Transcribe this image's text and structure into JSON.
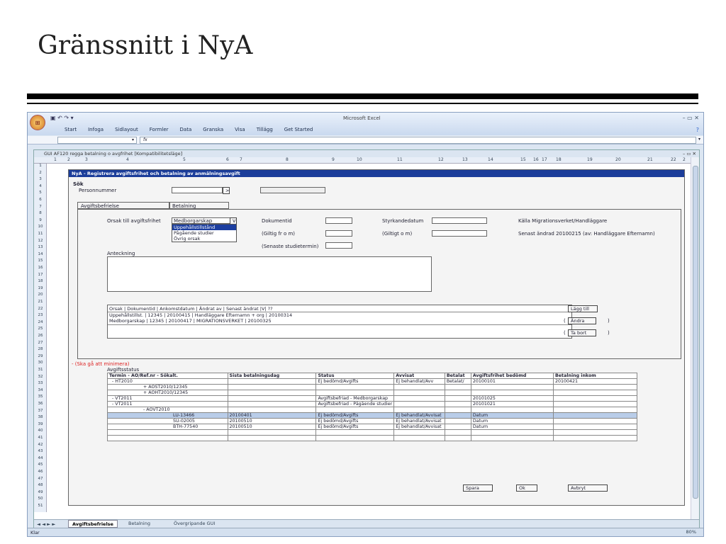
{
  "slide": {
    "title": "Gränssnitt i NyA"
  },
  "excel": {
    "app_title": "Microsoft Excel",
    "office_button": "⊞",
    "qat": "▣ ↶ ↷ ▾",
    "window_controls": "– ▭ ✕",
    "menus": [
      "Start",
      "Infoga",
      "Sidlayout",
      "Formler",
      "Data",
      "Granska",
      "Visa",
      "Tillägg",
      "Get Started"
    ],
    "fx_label": "fx",
    "workbook_title": "GUI AF120 regga betalning o avgfrihet  [Kompatibilitetsläge]",
    "col_headers": [
      "1",
      "2",
      "3",
      "4",
      "5",
      "6",
      "7",
      "8",
      "9",
      "10",
      "11",
      "12",
      "13",
      "14",
      "15",
      "16",
      "17",
      "18",
      "19",
      "20",
      "21",
      "22",
      "2"
    ],
    "row_count": 51,
    "sheet_tabs": [
      "Avgiftsbefrielse",
      "Betalning",
      "Övergripande GUI"
    ],
    "sheet_nav": "◄ ◄ ► ►",
    "status_ready": "Klar",
    "zoom": "80%"
  },
  "form": {
    "header_prefix": "NyA",
    "header_title": "NyA - Registrera avgiftsfrihet och betalning av anmälningsavgift",
    "sok_label": "Sök",
    "personnummer_label": "Personnummer",
    "search_button": ">",
    "tab_avgiftsbefrielse": "Avgiftsbefrielse",
    "tab_betalning": "Betalning",
    "orsak_label": "Orsak till avgiftsfrihet",
    "orsak_value": "Medborgarskap",
    "orsak_arrow": "V",
    "orsak_options": [
      "Uppehållstillstånd",
      "Pågående studier",
      "Övrig orsak"
    ],
    "dokumentid_label": "Dokumentid",
    "giltig_from_label": "(Giltig fr o m)",
    "senaste_label": "(Senaste studietermin)",
    "styrkande_label": "Styrkandedatum",
    "giltigt_om_label": "(Giltigt o m)",
    "kalla_label": "Källa  Migrationsverket/Handläggare",
    "senast_andrad": "Senast ändrad 20100215 (av: Handläggare Efternamn)",
    "anteckning_label": "Anteckning",
    "list_header": "Orsak                  |  Dokumentid  |  Ankomstdatum  | Ändrat av                                  | Senast ändrat |V| ??",
    "list_rows": [
      "Uppehållstillst. |  12345        |  20100415      |  Handläggare Efternamn + org        |  20100314",
      "Medborgarskap |  12345        |  20100417      |  MIGRATIONSVERKET                      |  20100325"
    ],
    "lagg_till": "Lägg till",
    "andra": "Ändra",
    "ta_bort": "Ta bort",
    "paren_open": "(",
    "paren_close": ")",
    "minimera_note": "- (Ska gå att minimera)",
    "avgiftsstatus_label": "Avgiftsstatus",
    "status_table": {
      "headers": [
        "Termin - AO/Ref.nr - Sökalt.",
        "Sista betalningsdag",
        "Status",
        "Avvisat",
        "Betalat",
        "Avgiftsfrihet bedömd",
        "Betalning inkom"
      ],
      "rows": [
        [
          "- HT2010",
          "",
          "Ej bedömd/Avgifts",
          "Ej behandlat/Avv",
          "Betalat/",
          "20100101",
          "20100421"
        ],
        [
          "+ AOST2010/12345",
          "",
          "",
          "",
          "",
          "",
          ""
        ],
        [
          "+ AOHT2010/12345",
          "",
          "",
          "",
          "",
          "",
          ""
        ],
        [
          "- VT2011",
          "",
          "Avgiftsbefriad - Medborgarskap",
          "",
          "",
          "20101025",
          ""
        ],
        [
          "- VT2011",
          "",
          "Avgiftsbefriad - Pågående studier",
          "",
          "",
          "20101021",
          ""
        ],
        [
          "- AOVT2010",
          "",
          "",
          "",
          "",
          "",
          ""
        ],
        [
          "LU-13466",
          "20100401",
          "Ej bedömd/Avgifts",
          "Ej behandlat/Avvisat",
          "",
          "Datum",
          ""
        ],
        [
          "SU-02005",
          "20100510",
          "Ej bedömd/Avgifts",
          "Ej behandlat/Avvisat",
          "",
          "Datum",
          ""
        ],
        [
          "BTH-77540",
          "20100510",
          "Ej bedömd/Avgifts",
          "Ej behandlat/Avvisat",
          "",
          "Datum",
          ""
        ]
      ]
    },
    "spara": "Spara",
    "ok": "Ok",
    "avbryt": "Avbryt"
  }
}
